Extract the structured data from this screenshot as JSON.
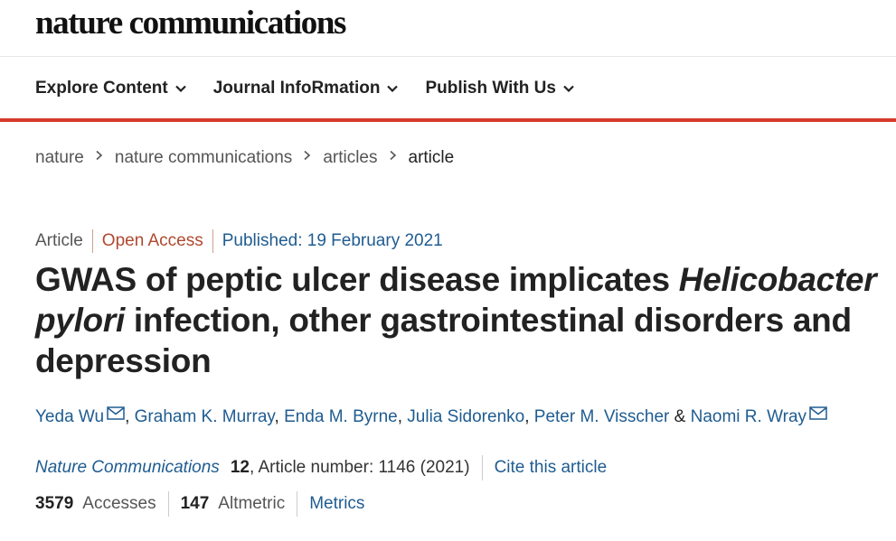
{
  "site": {
    "logo": "nature communications"
  },
  "nav": [
    {
      "label": "Explore Content"
    },
    {
      "label": "Journal InfoRmation"
    },
    {
      "label": "Publish With Us"
    }
  ],
  "breadcrumbs": [
    "nature",
    "nature communications",
    "articles",
    "article"
  ],
  "article": {
    "type": "Article",
    "access": "Open Access",
    "published": "Published: 19 February 2021",
    "title_part1": "GWAS of peptic ulcer disease implicates ",
    "title_italic": "Helicobacter pylori",
    "title_part2": " infection, other gastrointestinal disorders and depression",
    "authors": [
      "Yeda Wu",
      "Graham K. Murray",
      "Enda M. Byrne",
      "Julia Sidorenko",
      "Peter M. Visscher",
      "Naomi R. Wray"
    ],
    "author_separator": ", ",
    "author_last_separator": " & ",
    "journal": "Nature Communications",
    "volume": "12",
    "article_number": ", Article number: 1146 (2021)",
    "cite_label": "Cite this article"
  },
  "metrics": {
    "accesses_count": "3579",
    "accesses_label": "Accesses",
    "altmetric_count": "147",
    "altmetric_label": "Altmetric",
    "link_label": "Metrics"
  },
  "colors": {
    "accent_red": "#d63a2b",
    "link_blue": "#1f5c91",
    "open_access": "#b0492f"
  }
}
